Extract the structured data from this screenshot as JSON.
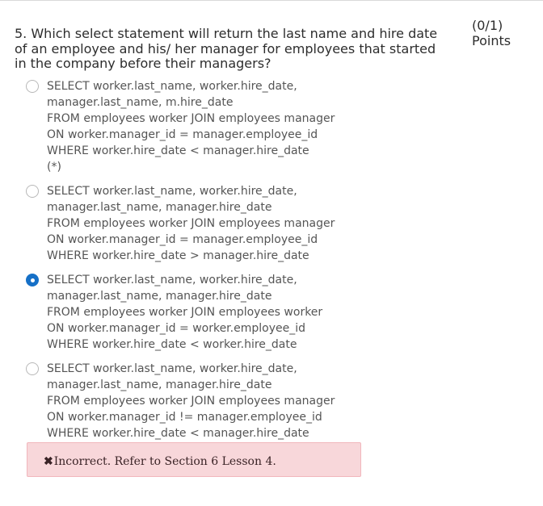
{
  "question": {
    "text": "5. Which select statement will return the last name and hire date of an employee and his/ her manager for employees that started in the company before their managers?",
    "points_score": "(0/1)",
    "points_label": "Points"
  },
  "options": [
    {
      "selected": false,
      "lines": [
        "SELECT worker.last_name, worker.hire_date,",
        "manager.last_name, m.hire_date",
        "FROM employees worker JOIN employees manager",
        "ON worker.manager_id = manager.employee_id",
        "WHERE worker.hire_date < manager.hire_date",
        "(*)"
      ]
    },
    {
      "selected": false,
      "lines": [
        "SELECT worker.last_name, worker.hire_date,",
        "manager.last_name, manager.hire_date",
        "FROM employees worker JOIN employees manager",
        "ON worker.manager_id = manager.employee_id",
        "WHERE worker.hire_date > manager.hire_date"
      ]
    },
    {
      "selected": true,
      "lines": [
        "SELECT worker.last_name, worker.hire_date,",
        "manager.last_name, manager.hire_date",
        "FROM employees worker JOIN employees worker",
        "ON worker.manager_id = worker.employee_id",
        "WHERE worker.hire_date < worker.hire_date"
      ]
    },
    {
      "selected": false,
      "lines": [
        "SELECT worker.last_name, worker.hire_date,",
        "manager.last_name, manager.hire_date",
        "FROM employees worker JOIN employees manager",
        "ON worker.manager_id != manager.employee_id",
        "WHERE worker.hire_date < manager.hire_date"
      ]
    }
  ],
  "feedback": {
    "icon": "x-icon",
    "icon_glyph": "✖",
    "text": "Incorrect. Refer to Section 6 Lesson 4.",
    "color": "#f8d7da"
  },
  "colors": {
    "radio_selected": "#1670c7",
    "text": "#555555"
  }
}
